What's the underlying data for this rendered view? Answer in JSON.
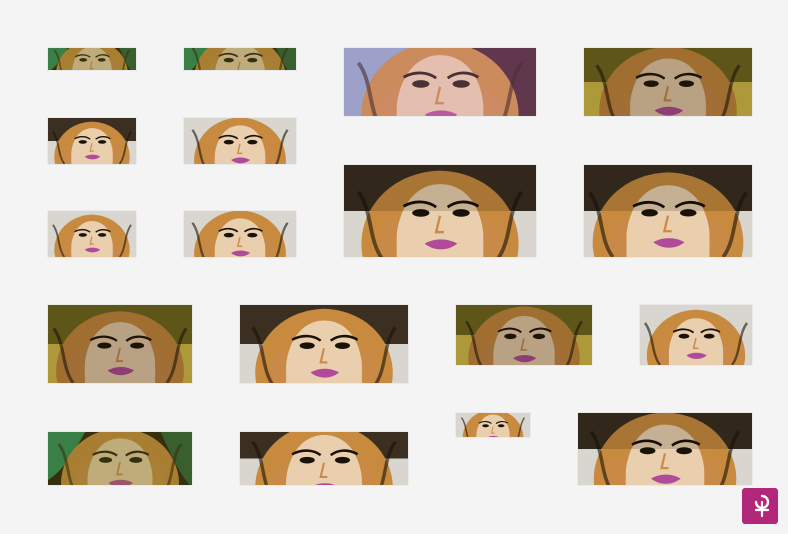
{
  "gallery": {
    "colors": {
      "background": "#f4f4f4",
      "skin_light": "#e9cfae",
      "skin_mid": "#c98a4a",
      "hair": "#c78a3e",
      "lips": "#b04a9a",
      "shadow": "#1a1208",
      "teal_accent": "#1e8a5c",
      "olive_accent": "#6f6a1e",
      "yellow_accent": "#d9c34a",
      "blue_accent": "#8aa6cf",
      "pink_accent": "#d98fb8",
      "dark_band": "#3a2f20",
      "light_band": "#d8d6cf"
    },
    "tiles": [
      {
        "variant": "teal"
      },
      {
        "variant": "teal"
      },
      {
        "variant": "blue-pink"
      },
      {
        "variant": "olive-yellow"
      },
      {
        "variant": "gray-band"
      },
      {
        "variant": "natural"
      },
      {
        "variant": "dark-band"
      },
      {
        "variant": "dark-band"
      },
      {
        "variant": "natural"
      },
      {
        "variant": "natural"
      },
      {
        "variant": "olive-yellow"
      },
      {
        "variant": "gray-band"
      },
      {
        "variant": "olive-yellow"
      },
      {
        "variant": "natural"
      },
      {
        "variant": "teal"
      },
      {
        "variant": "gray-band"
      },
      {
        "variant": "natural"
      },
      {
        "variant": "dark-band"
      }
    ]
  },
  "logo": {
    "icon": "brand-logo-icon",
    "color": "#b3277a"
  }
}
